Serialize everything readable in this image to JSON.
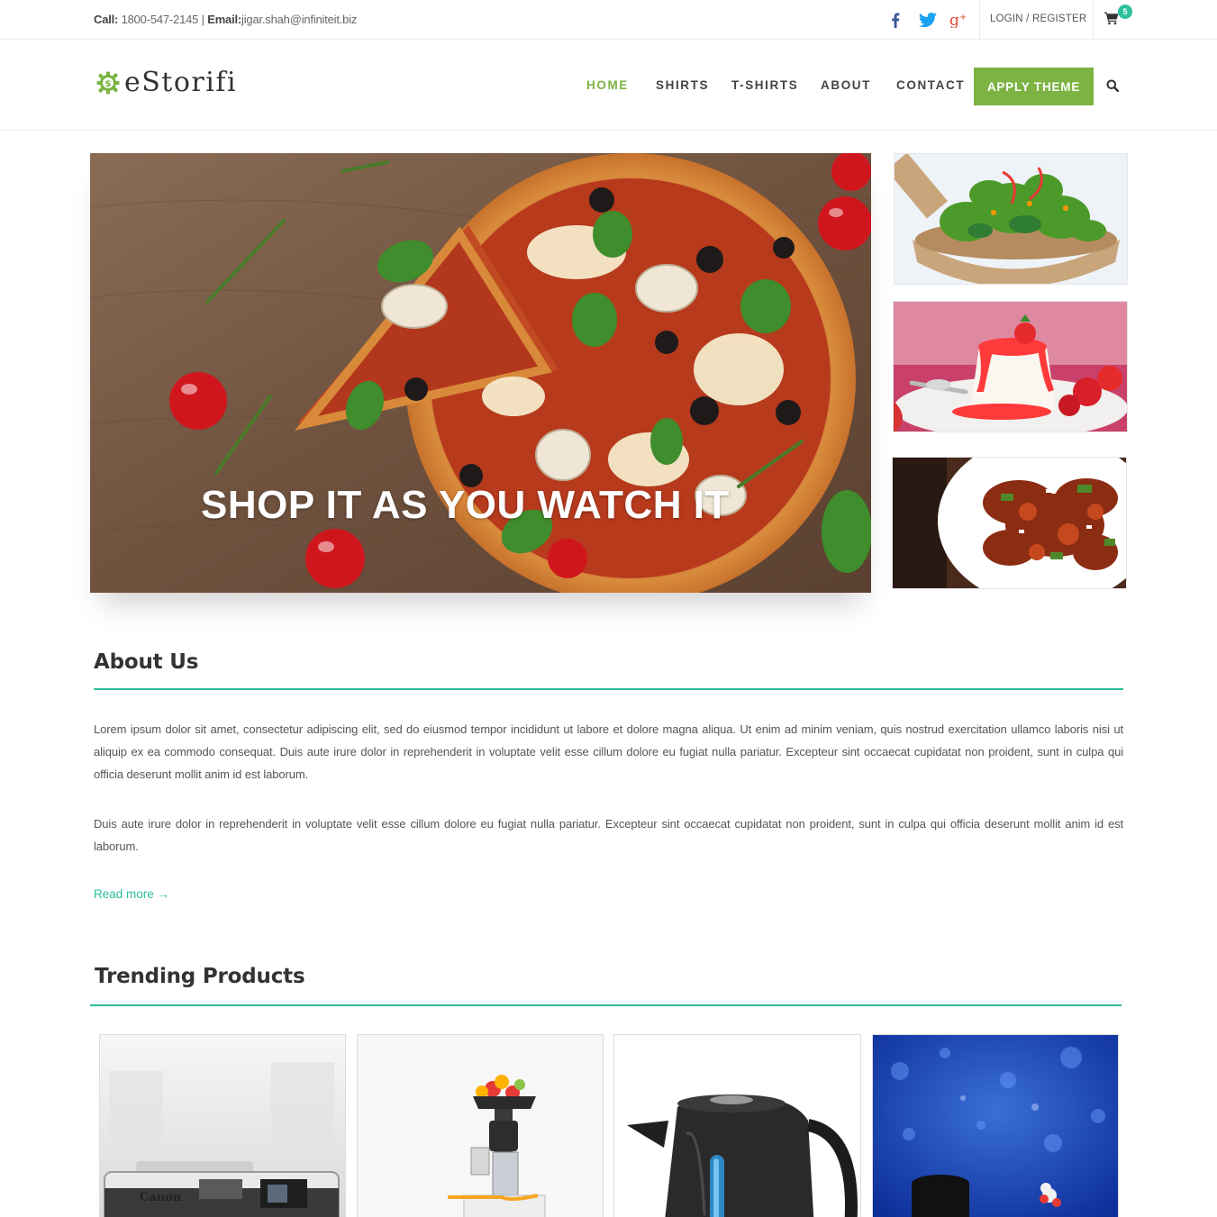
{
  "topbar": {
    "call_label": "Call:",
    "phone": "1800-547-2145",
    "separator": "|",
    "email_label": "Email:",
    "email": "jigar.shah@infiniteit.biz",
    "social": [
      "facebook-icon",
      "twitter-icon",
      "google-plus-icon"
    ],
    "login_label": "LOGIN / REGISTER",
    "cart_count": "5"
  },
  "header": {
    "logo_text": "eStorifi",
    "nav": {
      "home": "HOME",
      "shirts": "SHIRTS",
      "tshirts": "T-SHIRTS",
      "about": "ABOUT",
      "contact": "CONTACT"
    },
    "apply_label": "APPLY THEME"
  },
  "hero": {
    "caption": "SHOP IT AS YOU WATCH IT"
  },
  "about": {
    "title": "About Us",
    "paragraph1": "Lorem ipsum dolor sit amet, consectetur adipiscing elit, sed do eiusmod tempor incididunt ut labore et dolore magna aliqua. Ut enim ad minim veniam, quis nostrud exercitation ullamco laboris nisi ut aliquip ex ea commodo consequat. Duis aute irure dolor in reprehenderit in voluptate velit esse cillum dolore eu fugiat nulla pariatur. Excepteur sint occaecat cupidatat non proident, sunt in culpa qui officia deserunt mollit anim id est laborum.",
    "paragraph2": "Duis aute irure dolor in reprehenderit in voluptate velit esse cillum dolore eu fugiat nulla pariatur. Excepteur sint occaecat cupidatat non proident, sunt in culpa qui officia deserunt mollit anim id est laborum.",
    "read_more": "Read more →"
  },
  "trending": {
    "title": "Trending Products",
    "camera_brand": "Canon"
  },
  "colors": {
    "accent_green": "#7cb342",
    "teal": "#2bbf9c",
    "text": "#555555"
  }
}
